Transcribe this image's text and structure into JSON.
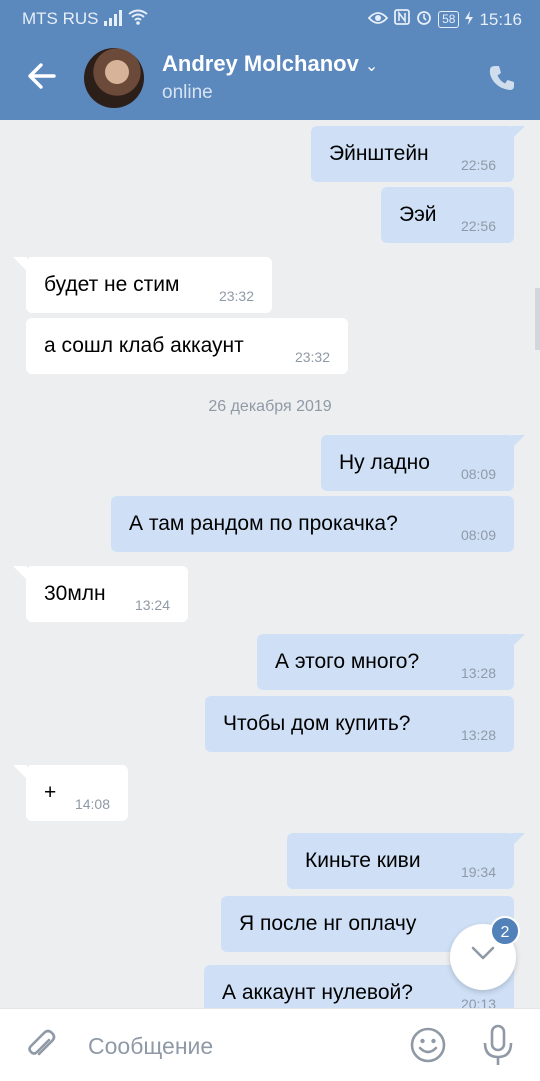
{
  "status_bar": {
    "carrier": "MTS RUS",
    "battery": "58",
    "time": "15:16"
  },
  "header": {
    "contact_name": "Andrey Molchanov",
    "contact_status": "online"
  },
  "messages": [
    {
      "dir": "out",
      "text": "Эйнштейн",
      "time": "22:56"
    },
    {
      "dir": "out",
      "text": "Ээй",
      "time": "22:56"
    },
    {
      "dir": "in",
      "text": "будет не стим",
      "time": "23:32"
    },
    {
      "dir": "in",
      "text": "а сошл клаб аккаунт",
      "time": "23:32"
    },
    {
      "dir": "out",
      "text": "Ну ладно",
      "time": "08:09"
    },
    {
      "dir": "out",
      "text": "А там рандом по прокачка?",
      "time": "08:09"
    },
    {
      "dir": "in",
      "text": "30млн",
      "time": "13:24"
    },
    {
      "dir": "out",
      "text": "А этого много?",
      "time": "13:28"
    },
    {
      "dir": "out",
      "text": "Чтобы дом купить?",
      "time": "13:28"
    },
    {
      "dir": "in",
      "text": "+",
      "time": "14:08"
    },
    {
      "dir": "out",
      "text": "Киньте киви",
      "time": "19:34"
    },
    {
      "dir": "out",
      "text": "Я после нг оплачу",
      "time": ""
    },
    {
      "dir": "out",
      "text": "А аккаунт нулевой?",
      "time": "20:13"
    }
  ],
  "date_separator": "26 декабря 2019",
  "unread_badge": "2",
  "composer": {
    "placeholder": "Сообщение"
  },
  "colors": {
    "header": "#5b88bd",
    "outgoing_bubble": "#cfe0f6",
    "incoming_bubble": "#ffffff",
    "badge": "#5181b8"
  },
  "icons": [
    "back-arrow-icon",
    "phone-icon",
    "attach-icon",
    "emoji-icon",
    "mic-icon",
    "chevron-down-icon"
  ]
}
